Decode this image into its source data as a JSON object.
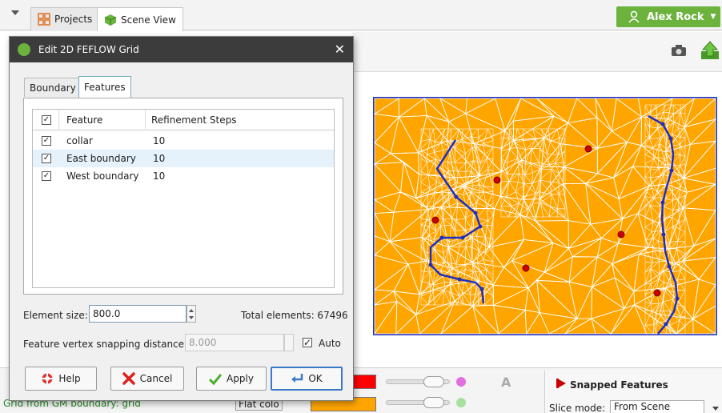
{
  "tabs": {
    "projects": "Projects",
    "scene": "Scene View"
  },
  "user": {
    "name": "Alex Rock"
  },
  "dialog": {
    "title": "Edit 2D FEFLOW Grid",
    "tabs": {
      "boundary_label": "Boundary",
      "features_label": "Features"
    },
    "table": {
      "headers": {
        "feature": "Feature",
        "refinement": "Refinement Steps"
      },
      "rows": [
        {
          "checked": true,
          "name": "collar",
          "steps": "10"
        },
        {
          "checked": true,
          "name": "East boundary",
          "steps": "10"
        },
        {
          "checked": true,
          "name": "West boundary",
          "steps": "10"
        }
      ]
    },
    "element_size": {
      "label": "Element size:",
      "value": "800.0"
    },
    "total_elements": "Total elements: 67496",
    "snapping": {
      "label": "Feature vertex snapping distance:",
      "value": "8.000",
      "auto_label": "Auto",
      "auto_checked": true
    },
    "buttons": {
      "help": "Help",
      "cancel": "Cancel",
      "apply": "Apply",
      "ok": "OK"
    }
  },
  "bottom": {
    "snapped_title": "Snapped Features",
    "slice_label": "Slice mode:",
    "slice_value": "From Scene",
    "tree_item": "Grid from GM boundary: grid",
    "flat_label": "Flat colo"
  },
  "colors": {
    "mesh_fill": "#ffa500",
    "feature_line": "#1f2fbf",
    "point": "#cc0000",
    "accent": "#6cb33e"
  }
}
